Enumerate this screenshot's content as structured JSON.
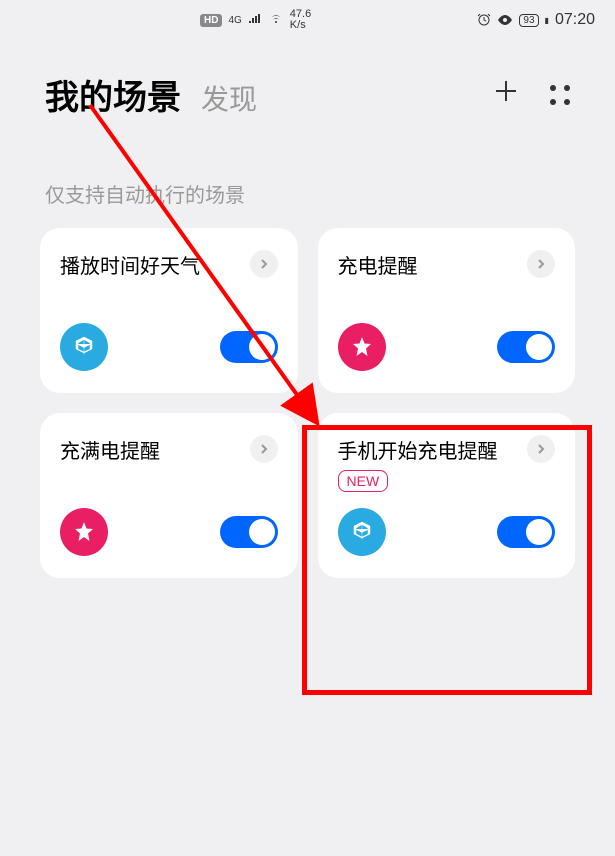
{
  "status": {
    "hd": "HD",
    "network": "4G",
    "speed_value": "47.6",
    "speed_unit": "K/s",
    "battery": "93",
    "time": "07:20"
  },
  "header": {
    "tab_active": "我的场景",
    "tab_inactive": "发现"
  },
  "section": {
    "label": "仅支持自动执行的场景"
  },
  "cards": [
    {
      "title": "播放时间好天气",
      "icon_type": "cube",
      "icon_color": "blue",
      "toggle": true
    },
    {
      "title": "充电提醒",
      "icon_type": "star",
      "icon_color": "pink",
      "toggle": true
    },
    {
      "title": "充满电提醒",
      "icon_type": "star",
      "icon_color": "pink",
      "toggle": true
    },
    {
      "title": "手机开始充电提醒",
      "badge": "NEW",
      "icon_type": "cube",
      "icon_color": "blue",
      "toggle": true
    }
  ]
}
